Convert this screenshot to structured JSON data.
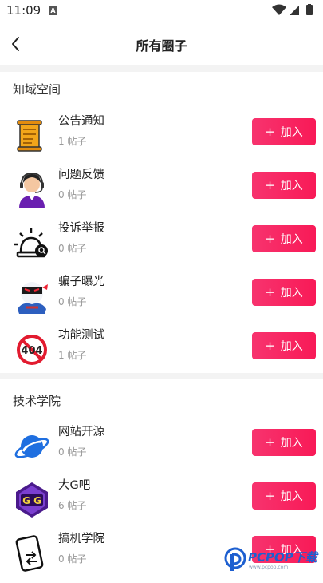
{
  "status": {
    "time": "11:09",
    "notification_badge": "A"
  },
  "header": {
    "title": "所有圈子"
  },
  "sections": [
    {
      "title": "知域空间",
      "items": [
        {
          "name": "公告通知",
          "meta": "1 帖子",
          "icon": "scroll-icon",
          "join_label": "加入"
        },
        {
          "name": "问题反馈",
          "meta": "0 帖子",
          "icon": "headset-agent-icon",
          "join_label": "加入"
        },
        {
          "name": "投诉举报",
          "meta": "0 帖子",
          "icon": "alarm-report-icon",
          "join_label": "加入"
        },
        {
          "name": "骗子曝光",
          "meta": "0 帖子",
          "icon": "ninja-icon",
          "join_label": "加入"
        },
        {
          "name": "功能测试",
          "meta": "1 帖子",
          "icon": "no-404-icon",
          "join_label": "加入"
        }
      ]
    },
    {
      "title": "技术学院",
      "items": [
        {
          "name": "网站开源",
          "meta": "0 帖子",
          "icon": "planet-icon",
          "join_label": "加入"
        },
        {
          "name": "大G吧",
          "meta": "6 帖子",
          "icon": "game-guardian-icon",
          "join_label": "加入"
        },
        {
          "name": "搞机学院",
          "meta": "0 帖子",
          "icon": "phone-transfer-icon",
          "join_label": "加入"
        }
      ]
    }
  ],
  "watermark": {
    "text": "PCPOP下载",
    "sub": "www.pcpop.com"
  },
  "colors": {
    "accent": "#f7336e",
    "separator": "#f3f3f3"
  }
}
